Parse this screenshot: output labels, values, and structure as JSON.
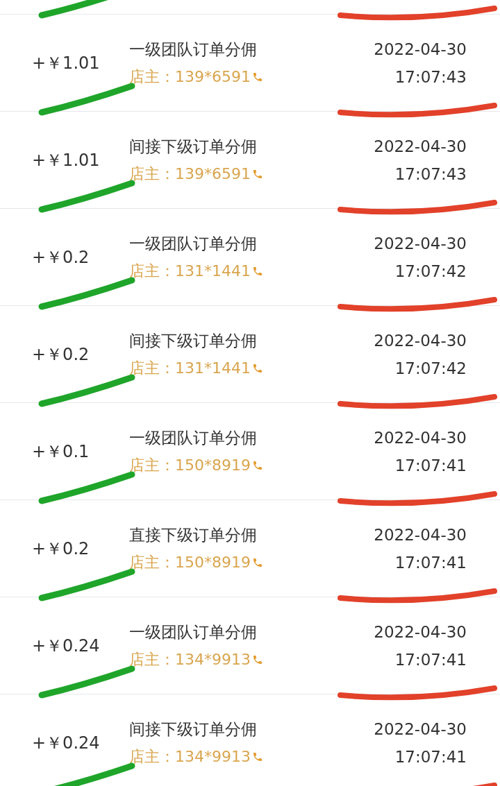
{
  "records": [
    {
      "amount": "+￥1.01",
      "title": "一级团队订单分佣",
      "shop": "店主：139*6591",
      "date": "2022-04-30",
      "time": "17:07:43"
    },
    {
      "amount": "+￥1.01",
      "title": "间接下级订单分佣",
      "shop": "店主：139*6591",
      "date": "2022-04-30",
      "time": "17:07:43"
    },
    {
      "amount": "+￥0.2",
      "title": "一级团队订单分佣",
      "shop": "店主：131*1441",
      "date": "2022-04-30",
      "time": "17:07:42"
    },
    {
      "amount": "+￥0.2",
      "title": "间接下级订单分佣",
      "shop": "店主：131*1441",
      "date": "2022-04-30",
      "time": "17:07:42"
    },
    {
      "amount": "+￥0.1",
      "title": "一级团队订单分佣",
      "shop": "店主：150*8919",
      "date": "2022-04-30",
      "time": "17:07:41"
    },
    {
      "amount": "+￥0.2",
      "title": "直接下级订单分佣",
      "shop": "店主：150*8919",
      "date": "2022-04-30",
      "time": "17:07:41"
    },
    {
      "amount": "+￥0.24",
      "title": "一级团队订单分佣",
      "shop": "店主：134*9913",
      "date": "2022-04-30",
      "time": "17:07:41"
    },
    {
      "amount": "+￥0.24",
      "title": "间接下级订单分佣",
      "shop": "店主：134*9913",
      "date": "2022-04-30",
      "time": "17:07:41"
    }
  ]
}
